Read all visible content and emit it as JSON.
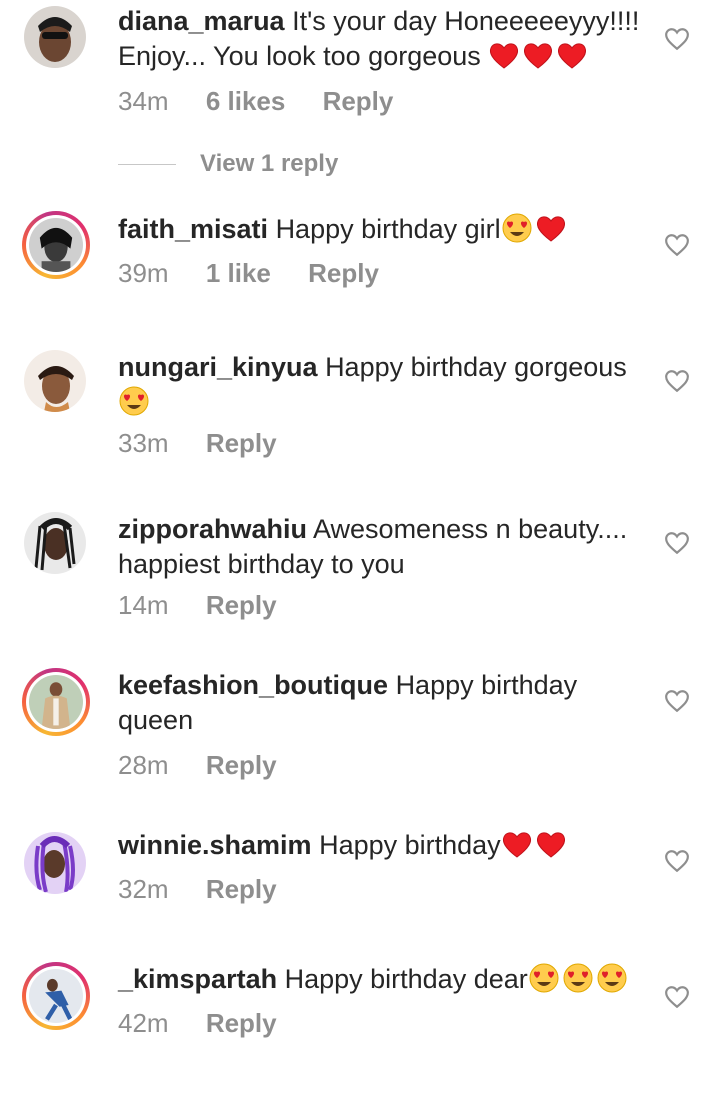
{
  "comments": [
    {
      "username": "diana_marua",
      "text": "It's your day Honeeeeeyyy!!!! Enjoy... You look too gorgeous",
      "time": "34m",
      "likes": "6 likes",
      "reply": "Reply",
      "emojis": [
        "heart",
        "heart",
        "heart"
      ]
    },
    {
      "username": "faith_misati",
      "text": "Happy birthday girl",
      "time": "39m",
      "likes": "1 like",
      "reply": "Reply",
      "emojis": [
        "heart-eyes",
        "heart"
      ]
    },
    {
      "username": "nungari_kinyua",
      "text": "Happy birthday gorgeous",
      "time": "33m",
      "reply": "Reply",
      "emojis": [
        "heart-eyes"
      ]
    },
    {
      "username": "zipporahwahiu",
      "text": "Awesomeness n beauty.... happiest birthday to you",
      "time": "14m",
      "reply": "Reply"
    },
    {
      "username": "keefashion_boutique",
      "text": "Happy birthday queen",
      "time": "28m",
      "reply": "Reply"
    },
    {
      "username": "winnie.shamim",
      "text": "Happy birthday",
      "time": "32m",
      "reply": "Reply",
      "emojis": [
        "heart",
        "heart"
      ]
    },
    {
      "username": "_kimspartah",
      "text": "Happy birthday dear",
      "time": "42m",
      "reply": "Reply",
      "emojis": [
        "heart-eyes",
        "heart-eyes",
        "heart-eyes"
      ]
    }
  ],
  "view_replies": "View 1 reply",
  "icons": {
    "like": "heart-outline-icon"
  },
  "colors": {
    "text": "#262626",
    "muted": "#8e8e8e",
    "heart": "#ed1c24"
  }
}
